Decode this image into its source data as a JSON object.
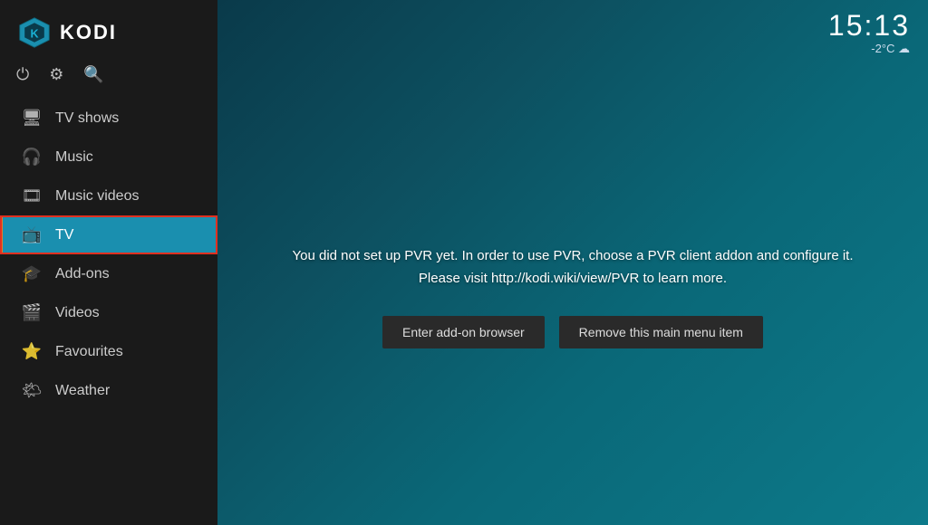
{
  "app": {
    "name": "KODI"
  },
  "clock": {
    "time": "15:13",
    "weather": "-2°C ☁"
  },
  "topIcons": [
    {
      "name": "power-icon",
      "symbol": "⏻"
    },
    {
      "name": "settings-icon",
      "symbol": "⚙"
    },
    {
      "name": "search-icon",
      "symbol": "🔍"
    }
  ],
  "sidebar": {
    "items": [
      {
        "id": "tv-shows",
        "label": "TV shows",
        "icon": "🖥"
      },
      {
        "id": "music",
        "label": "Music",
        "icon": "🎧"
      },
      {
        "id": "music-videos",
        "label": "Music videos",
        "icon": "🎞"
      },
      {
        "id": "tv",
        "label": "TV",
        "icon": "📺",
        "active": true
      },
      {
        "id": "add-ons",
        "label": "Add-ons",
        "icon": "🎓"
      },
      {
        "id": "videos",
        "label": "Videos",
        "icon": "🎬"
      },
      {
        "id": "favourites",
        "label": "Favourites",
        "icon": "⭐"
      },
      {
        "id": "weather",
        "label": "Weather",
        "icon": "🌤"
      }
    ]
  },
  "pvr": {
    "message": "You did not set up PVR yet. In order to use PVR, choose a PVR client addon and configure it.",
    "message2": "Please visit http://kodi.wiki/view/PVR to learn more.",
    "button1": "Enter add-on browser",
    "button2": "Remove this main menu item"
  }
}
